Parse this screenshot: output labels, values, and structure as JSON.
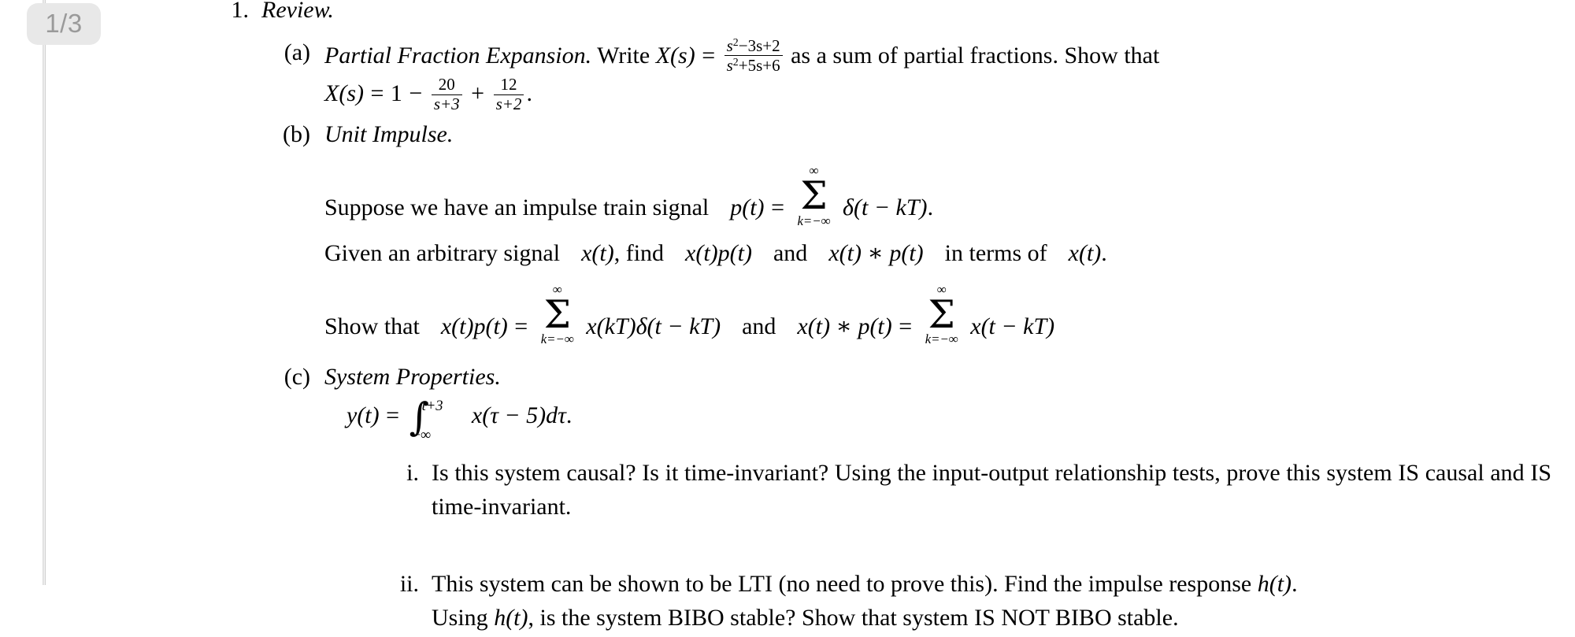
{
  "viewer": {
    "page_badge": "1/3",
    "badge_bg": "#e8e8e8",
    "badge_fg": "#9a9a9a",
    "page_bg": "#ffffff",
    "text_color": "#000000"
  },
  "document": {
    "problems": [
      {
        "marker": "1.",
        "title": "Review.",
        "parts": [
          {
            "marker": "(a)",
            "title": "Partial Fraction Expansion.",
            "text_before": "Write",
            "lhs": "X(s)",
            "eq": "=",
            "fraction": {
              "numerator": "s²−3s+2",
              "denominator": "s²+5s+6"
            },
            "numerator_plain": "s",
            "numerator_exp": "2",
            "numerator_rest": "−3s+2",
            "denominator_plain": "s",
            "denominator_exp": "2",
            "denominator_rest": "+5s+6",
            "text_after": "as a sum of partial fractions.  Show that",
            "result": {
              "lhs": "X(s)",
              "eq": "=",
              "one": "1",
              "minus": "−",
              "frac1_num": "20",
              "frac1_den": "s+3",
              "plus": "+",
              "frac2_num": "12",
              "frac2_den": "s+2",
              "period": "."
            }
          },
          {
            "marker": "(b)",
            "title": "Unit Impulse.",
            "lines": [
              {
                "id": "impulse-train",
                "pre": "Suppose we have an impulse train signal",
                "lhs": "p(t)",
                "eq": "=",
                "sum_top": "∞",
                "sum_bot": "k=−∞",
                "expr": "δ(t − kT)",
                "post": "."
              },
              {
                "id": "given-arbitrary",
                "text": "Given an arbitrary signal x(t), find x(t)p(t) and x(t) ∗ p(t) in terms of x(t).",
                "seg1": "Given an arbitrary signal",
                "m1": "x(t)",
                "seg2": ", find",
                "m2": "x(t)p(t)",
                "seg3": "and",
                "m3": "x(t) ∗ p(t)",
                "seg4": "in terms of",
                "m4": "x(t)",
                "seg5": "."
              },
              {
                "id": "show-that",
                "pre": "Show that",
                "lhs1": "x(t)p(t)",
                "eq1": "=",
                "sum1_top": "∞",
                "sum1_bot": "k=−∞",
                "expr1": "x(kT)δ(t − kT)",
                "mid": "and",
                "lhs2": "x(t) ∗ p(t)",
                "eq2": "=",
                "sum2_top": "∞",
                "sum2_bot": "k=−∞",
                "expr2": "x(t − kT)"
              }
            ]
          },
          {
            "marker": "(c)",
            "title": "System Properties.",
            "equation": {
              "lhs": "y(t)",
              "eq": "=",
              "int_upper": "t+3",
              "int_lower": "−∞",
              "integrand": "x(τ − 5)dτ",
              "period": "."
            },
            "subparts": [
              {
                "marker": "i.",
                "text": "Is this system causal?  Is it time-invariant?  Using the input-output relationship tests, prove this system IS causal and IS time-invariant."
              },
              {
                "marker": "ii.",
                "line1_pre": "This system can be shown to be LTI (no need to prove this).  Find the impulse response",
                "line1_m": "h(t)",
                "line1_post": ".",
                "line2_pre": "Using",
                "line2_m": "h(t)",
                "line2_post": ", is the system BIBO stable?  Show that system IS NOT BIBO stable."
              }
            ]
          }
        ]
      }
    ]
  }
}
